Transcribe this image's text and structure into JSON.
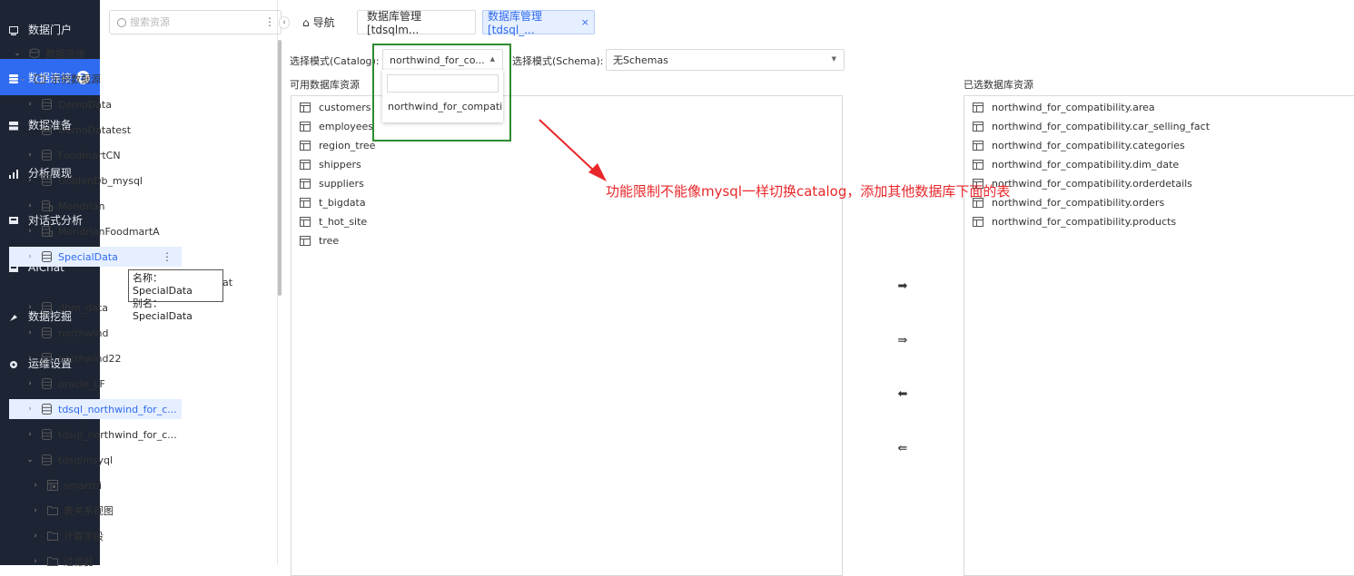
{
  "nav": {
    "items": [
      {
        "label": "数据门户",
        "icon": "portal-icon"
      },
      {
        "label": "数据连接",
        "icon": "database-icon",
        "badge": "2",
        "active": true
      },
      {
        "label": "数据准备",
        "icon": "prep-icon"
      },
      {
        "label": "分析展现",
        "icon": "bar-chart-icon"
      },
      {
        "label": "对话式分析",
        "icon": "chat-icon"
      },
      {
        "label": "AIChat",
        "icon": "ai-chat-icon"
      },
      {
        "label": "数据挖掘",
        "icon": "mining-icon"
      },
      {
        "label": "运维设置",
        "icon": "gear-icon"
      }
    ]
  },
  "search": {
    "placeholder": "搜索资源"
  },
  "tree": {
    "rows": [
      {
        "label": "数据连接",
        "arrow": "⌄",
        "icon": "connection-icon",
        "indent": 0
      },
      {
        "label": "示例数据源",
        "arrow": "⌄",
        "icon": "folder-icon",
        "indent": 1
      },
      {
        "label": "DemoData",
        "arrow": "›",
        "icon": "database-icon",
        "indent": 2
      },
      {
        "label": "DemoDatatest",
        "arrow": "›",
        "icon": "database-icon",
        "indent": 2
      },
      {
        "label": "FoodmartCN",
        "arrow": "›",
        "icon": "database-icon",
        "indent": 2
      },
      {
        "label": "GoldenDb_mysql",
        "arrow": "›",
        "icon": "database-icon",
        "indent": 2
      },
      {
        "label": "Mondrian",
        "arrow": "›",
        "icon": "cube-icon",
        "indent": 2
      },
      {
        "label": "MondrianFoodmartA",
        "arrow": "›",
        "icon": "cube-icon",
        "indent": 2
      },
      {
        "label": "SpecialData",
        "arrow": "›",
        "icon": "database-icon",
        "indent": 2,
        "hover": true
      },
      {
        "label": "",
        "arrow": "",
        "icon": "",
        "indent": 2
      },
      {
        "label": "dbm_data",
        "arrow": "›",
        "icon": "database-icon",
        "indent": 2
      },
      {
        "label": "northwind",
        "arrow": "›",
        "icon": "database-icon",
        "indent": 2
      },
      {
        "label": "northwind22",
        "arrow": "›",
        "icon": "database-icon",
        "indent": 2
      },
      {
        "label": "oracle_LF",
        "arrow": "›",
        "icon": "database-icon",
        "indent": 2
      },
      {
        "label": "tdsql_northwind_for_c...",
        "arrow": "›",
        "icon": "database-icon",
        "indent": 2,
        "selected": true
      },
      {
        "label": "tdsql_northwind_for_c...",
        "arrow": "›",
        "icon": "database-icon",
        "indent": 2
      },
      {
        "label": "tdsqlmsyql",
        "arrow": "⌄",
        "icon": "database-icon",
        "indent": 2
      },
      {
        "label": "smartbi",
        "arrow": "›",
        "icon": "schema-icon",
        "indent": 3
      },
      {
        "label": "表关系视图",
        "arrow": "›",
        "icon": "folder-icon",
        "indent": 3
      },
      {
        "label": "计算字段",
        "arrow": "›",
        "icon": "folder-icon",
        "indent": 3
      },
      {
        "label": "过滤器",
        "arrow": "›",
        "icon": "folder-icon",
        "indent": 3
      }
    ],
    "tooltip": {
      "name_line": "名称：SpecialData",
      "alias_line": "别名：SpecialData",
      "behind_text": "at"
    }
  },
  "tabs": [
    {
      "label": "导航",
      "icon": "home-icon"
    },
    {
      "label": "数据库管理[tdsqlm..."
    },
    {
      "label": "数据库管理[tdsql_...",
      "active": true,
      "close": "×"
    }
  ],
  "schema": {
    "catalog_label": "选择模式(Catalog):",
    "catalog_value": "northwind_for_co...",
    "catalog_option": "northwind_for_compatib",
    "schema_label": "选择模式(Schema):",
    "schema_value": "无Schemas"
  },
  "available": {
    "title": "可用数据库资源",
    "items": [
      "customers",
      "employees",
      "region_tree",
      "shippers",
      "suppliers",
      "t_bigdata",
      "t_hot_site",
      "tree"
    ]
  },
  "selected": {
    "title": "已选数据库资源",
    "items": [
      "northwind_for_compatibility.area",
      "northwind_for_compatibility.car_selling_fact",
      "northwind_for_compatibility.categories",
      "northwind_for_compatibility.dim_date",
      "northwind_for_compatibility.orderdetails",
      "northwind_for_compatibility.orders",
      "northwind_for_compatibility.products"
    ]
  },
  "transfer": {
    "add": "➡",
    "add_all": "⇛",
    "remove": "⬅",
    "remove_all": "⇚"
  },
  "annotation": {
    "text": "功能限制不能像mysql一样切换catalog，添加其他数据库下面的表",
    "color": "#e8262a"
  },
  "colors": {
    "accent": "#2f6bf0",
    "nav_bg": "#1d2433",
    "highlight_box": "#2e8b2e"
  }
}
